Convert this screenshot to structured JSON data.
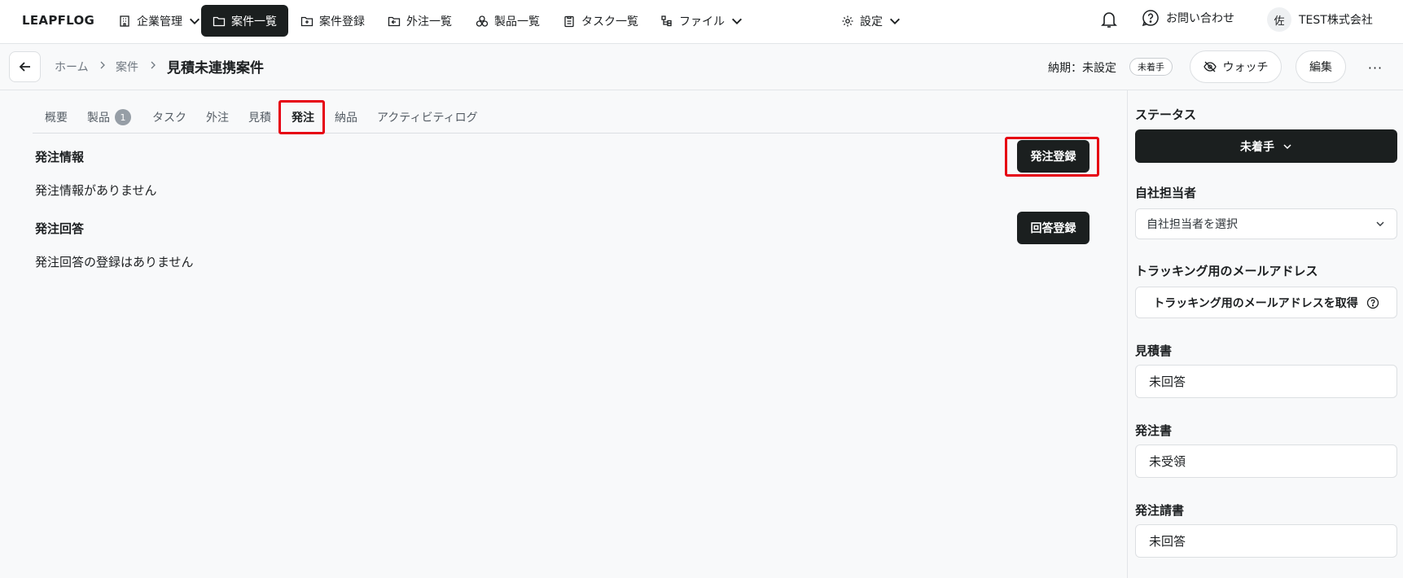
{
  "app": {
    "logo": "LEAPFLOG"
  },
  "nav": {
    "items": [
      {
        "label": "企業管理",
        "icon": "building-icon",
        "dropdown": true
      },
      {
        "label": "案件一覧",
        "icon": "folder-icon",
        "active": true
      },
      {
        "label": "案件登録",
        "icon": "folder-plus-icon"
      },
      {
        "label": "外注一覧",
        "icon": "outsource-icon"
      },
      {
        "label": "製品一覧",
        "icon": "boxes-icon"
      },
      {
        "label": "タスク一覧",
        "icon": "clipboard-icon"
      },
      {
        "label": "ファイル",
        "icon": "file-tree-icon",
        "dropdown": true
      },
      {
        "label": "設定",
        "icon": "gear-icon",
        "dropdown": true
      }
    ],
    "help_label": "お問い合わせ",
    "user_initial": "佐",
    "company": "TEST株式会社"
  },
  "header": {
    "breadcrumb": [
      "ホーム",
      "案件"
    ],
    "title": "見積未連携案件",
    "deadline": "納期：未設定",
    "status_badge": "未着手",
    "watch_label": "ウォッチ",
    "edit_label": "編集",
    "more_label": "···"
  },
  "tabs": [
    {
      "label": "概要"
    },
    {
      "label": "製品",
      "count": "1"
    },
    {
      "label": "タスク"
    },
    {
      "label": "外注"
    },
    {
      "label": "見積"
    },
    {
      "label": "発注",
      "active": true
    },
    {
      "label": "納品"
    },
    {
      "label": "アクティビティログ"
    }
  ],
  "main": {
    "order_info": {
      "title": "発注情報",
      "empty": "発注情報がありません",
      "button": "発注登録"
    },
    "order_reply": {
      "title": "発注回答",
      "empty": "発注回答の登録はありません",
      "button": "回答登録"
    }
  },
  "sidebar": {
    "status": {
      "label": "ステータス",
      "value": "未着手"
    },
    "assignee": {
      "label": "自社担当者",
      "placeholder": "自社担当者を選択"
    },
    "tracking": {
      "label": "トラッキング用のメールアドレス",
      "button": "トラッキング用のメールアドレスを取得"
    },
    "estimate": {
      "label": "見積書",
      "value": "未回答"
    },
    "purchase_order": {
      "label": "発注書",
      "value": "未受領"
    },
    "invoice": {
      "label": "発注請書",
      "value": "未回答"
    }
  },
  "colors": {
    "primary_dark": "#1b1f1f",
    "highlight": "#e60012",
    "background": "#f8f9fa"
  }
}
